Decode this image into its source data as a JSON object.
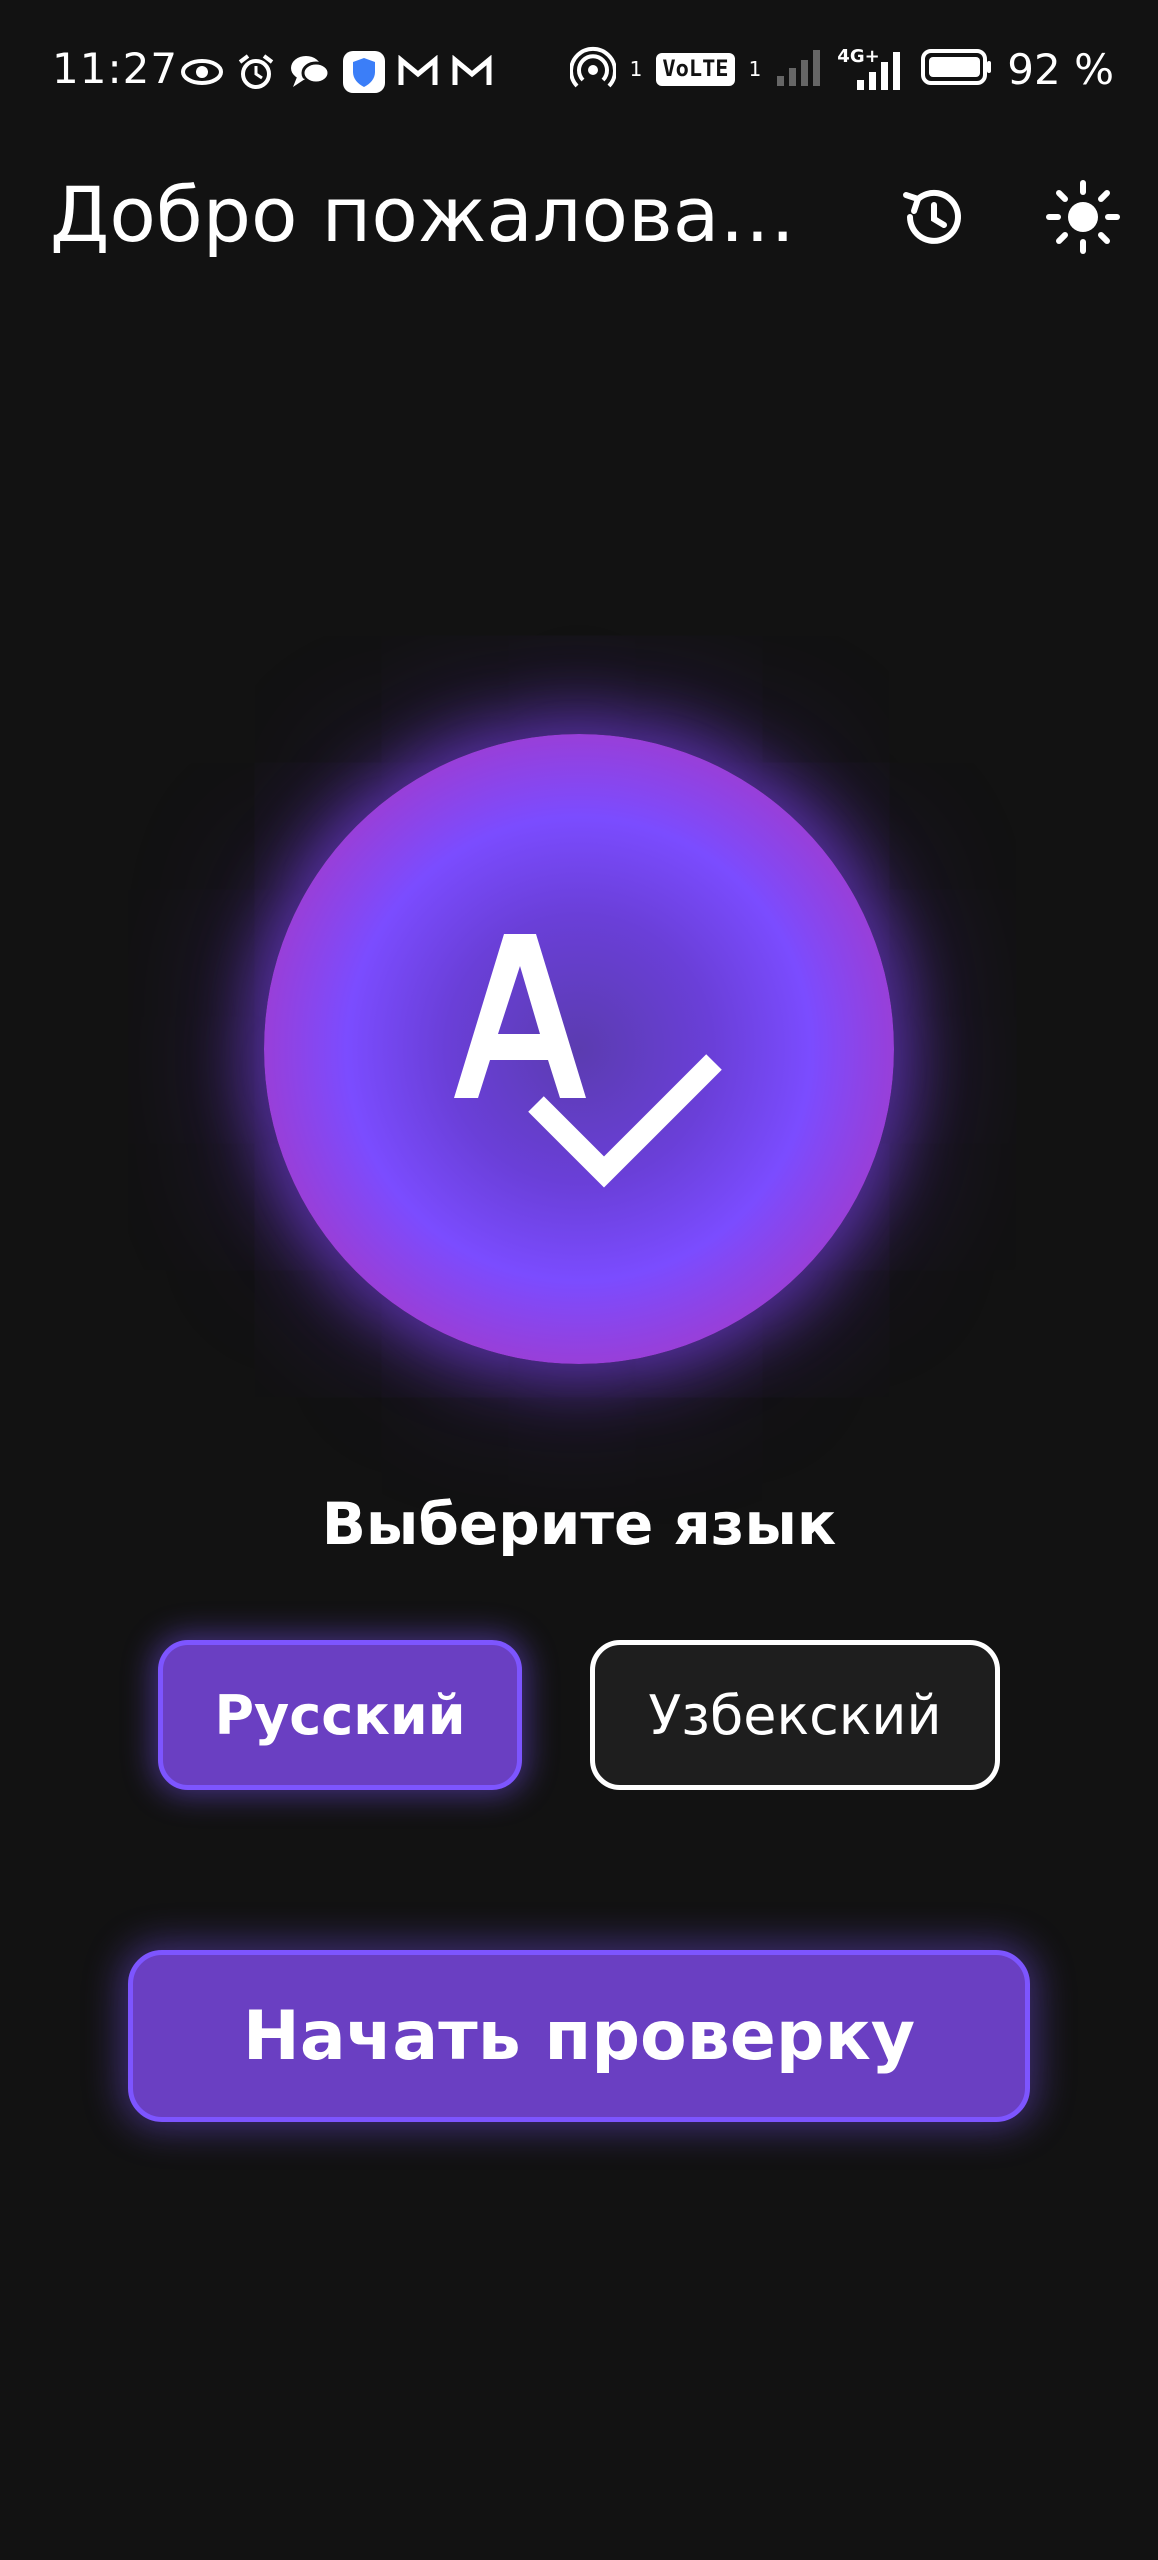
{
  "status_bar": {
    "time": "11:27",
    "left_icons": [
      "eye-icon",
      "alarm-icon",
      "chat-icon",
      "shield-icon",
      "gmail-icon",
      "gmail-icon"
    ],
    "hotspot_sup": "1",
    "volte_label": "VoLTE",
    "volte_sub": "1",
    "network_label": "4G+",
    "battery_percent": "92 %"
  },
  "header": {
    "title": "Добро пожаловать..."
  },
  "logo": {
    "icon": "spellcheck-icon",
    "letter": "A"
  },
  "language": {
    "title": "Выберите язык",
    "options": [
      {
        "label": "Русский",
        "selected": true
      },
      {
        "label": "Узбекский",
        "selected": false
      }
    ]
  },
  "actions": {
    "start_label": "Начать проверку"
  },
  "colors": {
    "background": "#121212",
    "accent": "#6a3fc2",
    "accent_border": "#7d55ff",
    "circle_outer": "#a62fc6"
  }
}
